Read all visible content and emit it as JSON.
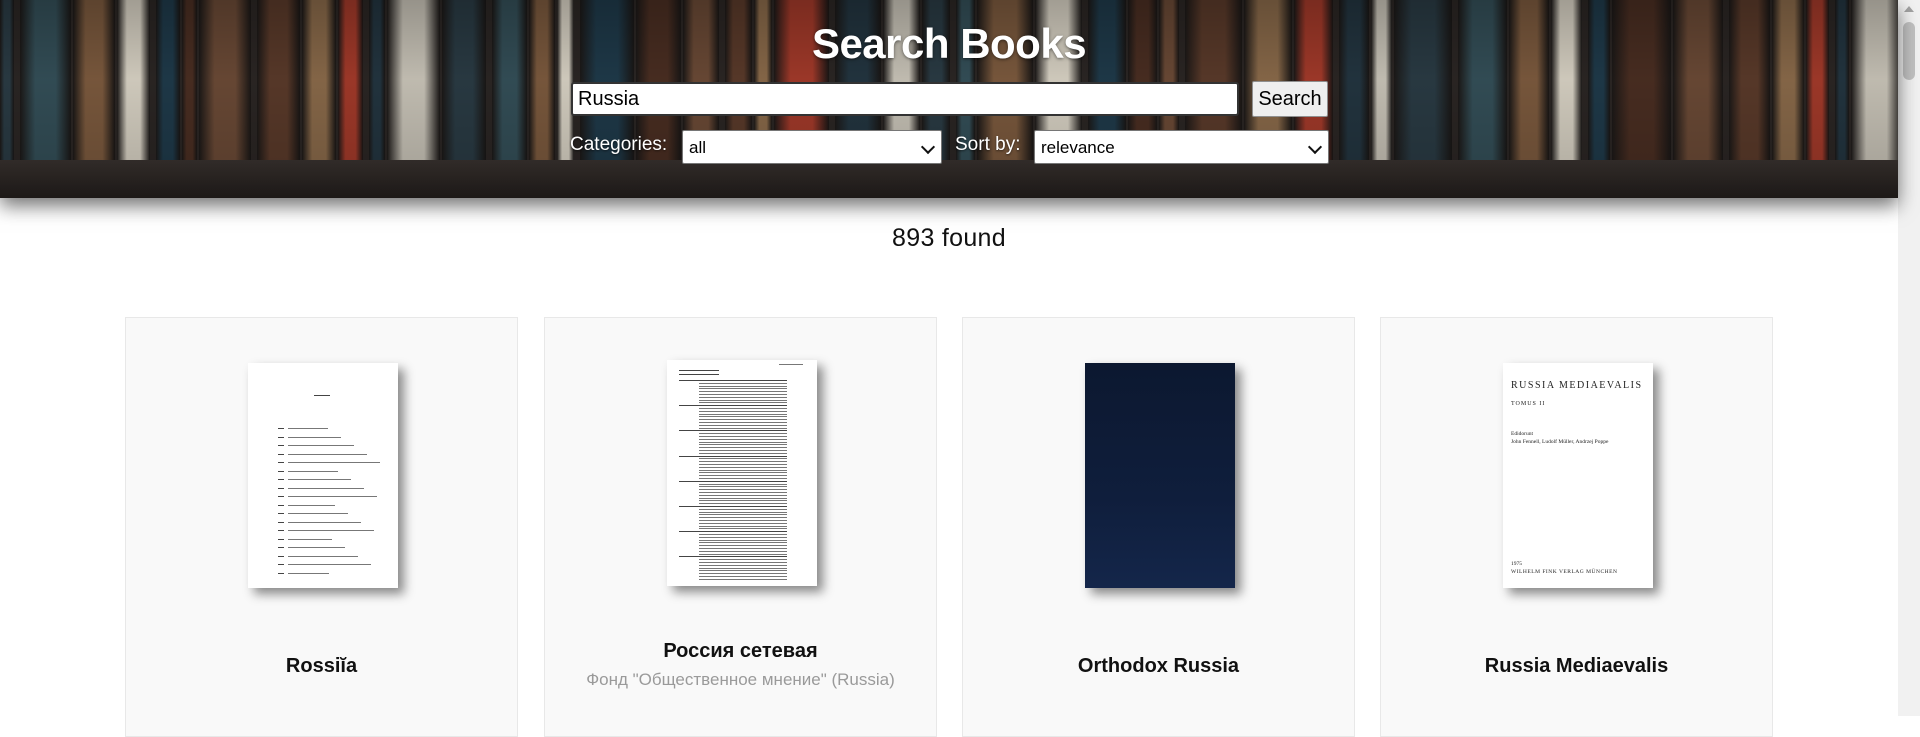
{
  "header": {
    "title": "Search Books",
    "search": {
      "value": "Russia",
      "button_label": "Search"
    },
    "filters": {
      "categories_label": "Categories:",
      "categories_value": "all",
      "sort_label": "Sort by:",
      "sort_value": "relevance"
    }
  },
  "results": {
    "count_text": "893 found",
    "books": [
      {
        "title": "Rossiĭa",
        "author": "",
        "cover_icon": "book-cover-index-page"
      },
      {
        "title": "Россия сетевая",
        "author": "Фонд \"Общественное мнение\" (Russia)",
        "cover_icon": "book-cover-contents-page"
      },
      {
        "title": "Orthodox Russia",
        "author": "",
        "cover_icon": "book-cover-dark-blue"
      },
      {
        "title": "Russia Mediaevalis",
        "author": "",
        "cover_icon": "book-cover-title-page",
        "cover_text": {
          "heading": "RUSSIA MEDIAEVALIS",
          "volume": "TOMUS II",
          "editors_label": "Edidorunt",
          "editors": "John Fennell, Ludolf Müller, Andrzej Poppe",
          "year": "1975",
          "publisher": "WILHELM FINK VERLAG MÜNCHEN"
        }
      }
    ]
  },
  "colors": {
    "header_text": "#ffffff",
    "card_bg": "#f9f9f9",
    "author_text": "#9a9a9a",
    "dark_cover": "#0d1a33"
  }
}
